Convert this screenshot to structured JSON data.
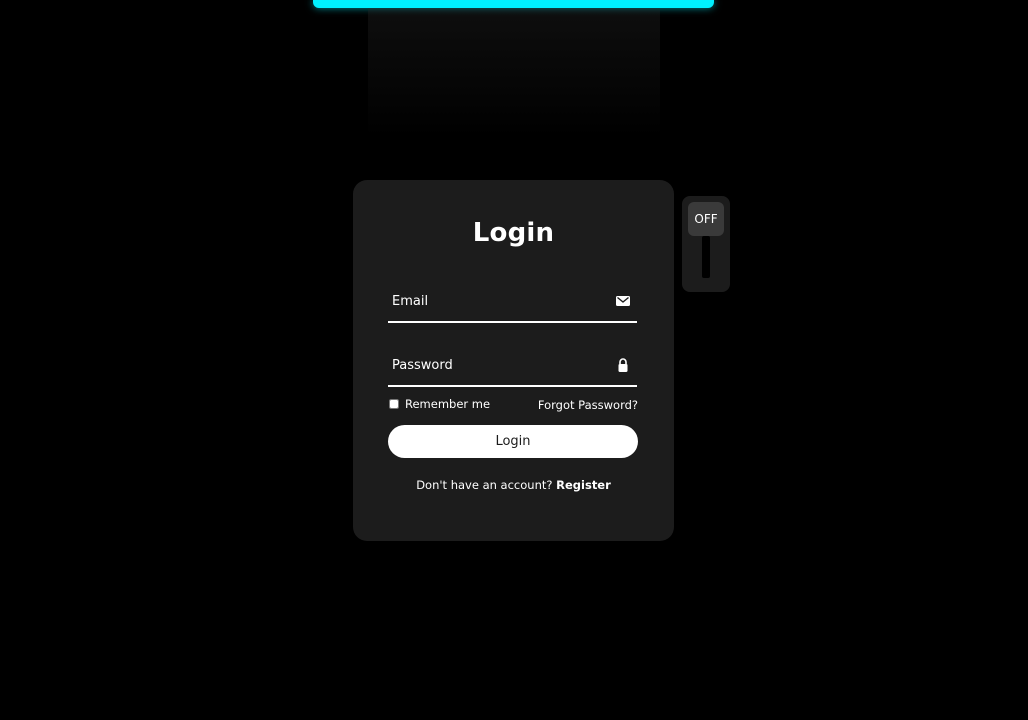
{
  "lamp": {
    "accent_color": "#00f0ff"
  },
  "login_form": {
    "title": "Login",
    "email": {
      "placeholder": "Email",
      "value": "",
      "icon": "envelope-icon"
    },
    "password": {
      "placeholder": "Password",
      "value": "",
      "icon": "lock-icon"
    },
    "remember_label": "Remember me",
    "remember_checked": false,
    "forgot_label": "Forgot Password?",
    "submit_label": "Login",
    "register_prompt": "Don't have an account?",
    "register_link": "Register"
  },
  "lamp_switch": {
    "state_label": "OFF"
  },
  "colors": {
    "background": "#000000",
    "card": "#1c1c1c",
    "text": "#ffffff"
  }
}
